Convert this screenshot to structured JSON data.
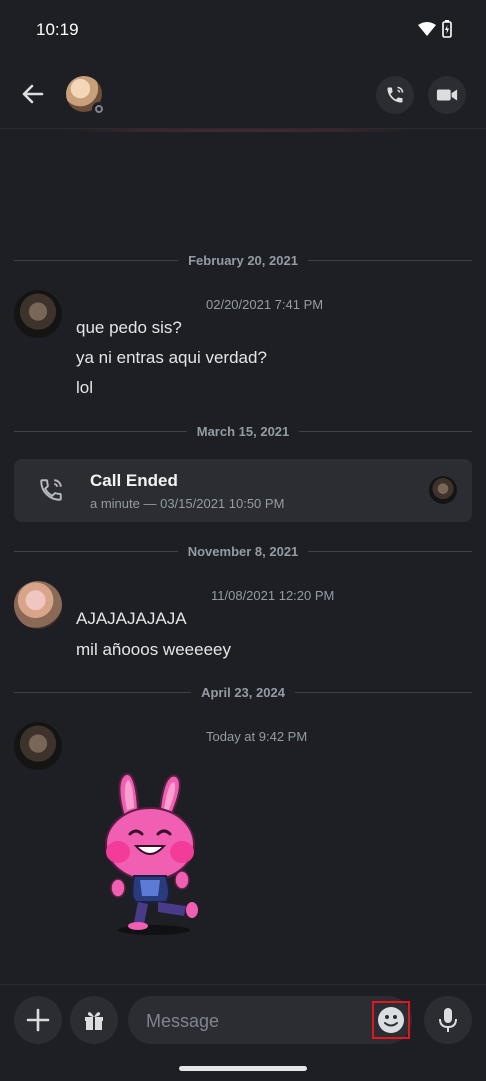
{
  "status_bar": {
    "time": "10:19"
  },
  "dividers": [
    "February 20, 2021",
    "March 15, 2021",
    "November 8, 2021",
    "April 23, 2024"
  ],
  "messages": [
    {
      "timestamp": "02/20/2021 7:41 PM",
      "lines": [
        "que pedo sis?",
        "ya ni entras aqui verdad?",
        "lol"
      ]
    },
    {
      "timestamp": "11/08/2021 12:20 PM",
      "lines": [
        "AJAJAJAJAJA",
        "mil añooos weeeeey"
      ]
    },
    {
      "timestamp": "Today at 9:42 PM",
      "lines": []
    }
  ],
  "call": {
    "title": "Call Ended",
    "subtitle": "a minute — 03/15/2021 10:50 PM"
  },
  "composer": {
    "placeholder": "Message"
  },
  "colors": {
    "background": "#1e1f24",
    "surface": "#2b2d33",
    "highlight": "#e0171f",
    "sticker_pink": "#f05fb1"
  }
}
